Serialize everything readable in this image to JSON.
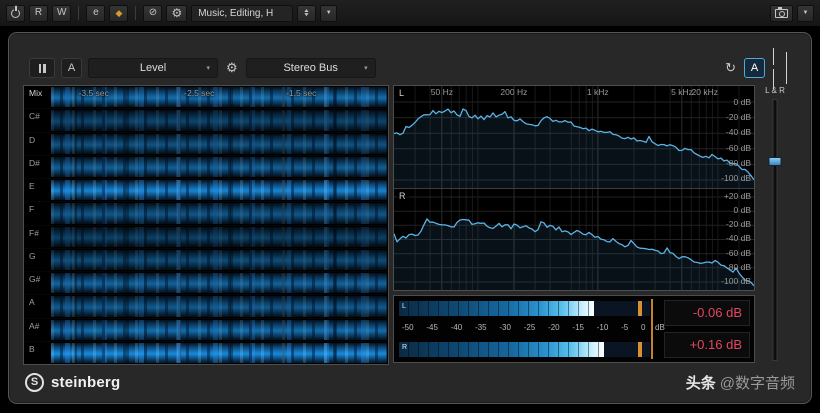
{
  "top_toolbar": {
    "read_button": "R",
    "write_button": "W",
    "edit_button": "e",
    "compare_icon": "◆",
    "bypass_icon": "⊘",
    "gear_icon": "⚙",
    "preset_value": "Music, Editing, H",
    "prev_icon": "▲",
    "next_icon": "▼",
    "menu_icon": "▼",
    "output_menu_icon": "▼"
  },
  "plugin": {
    "header": {
      "ab_button": "A",
      "module_select": "Level",
      "gear_icon": "⚙",
      "source_select": "Stereo Bus",
      "reset_icon": "↻",
      "snapshot_button": "A",
      "dropdown_icon": "▾"
    },
    "spectrogram": {
      "channel_label": "Mix",
      "time_labels": [
        "-3.5 sec",
        "-2.5 sec",
        "-1.5 sec"
      ],
      "note_labels": [
        "C#",
        "D",
        "D#",
        "E",
        "F",
        "F#",
        "G",
        "G#",
        "A",
        "A#",
        "B"
      ]
    },
    "spectrum": {
      "freq_labels": [
        "50 Hz",
        "200 Hz",
        "1 kHz",
        "5 kHz",
        "20 kHz"
      ],
      "left_channel": "L",
      "right_channel": "R",
      "left_db_labels": [
        "0 dB",
        "-20 dB",
        "-40 dB",
        "-60 dB",
        "-80 dB",
        "-100 dB"
      ],
      "right_db_labels": [
        "+20 dB",
        "0 dB",
        "-20 dB",
        "-40 dB",
        "-60 dB",
        "-80 dB",
        "-100 dB"
      ]
    },
    "meter": {
      "left_channel": "L",
      "right_channel": "R",
      "scale_ticks": [
        "-50",
        "-45",
        "-40",
        "-35",
        "-30",
        "-25",
        "-20",
        "-15",
        "-10",
        "-5",
        "0"
      ],
      "unit_label": "dB",
      "left_readout": "-0.06 dB",
      "right_readout": "+0.16 dB",
      "left_fill_pct": 78,
      "right_fill_pct": 82
    },
    "fader": {
      "label": "L & R"
    }
  },
  "footer": {
    "brand": "steinberg"
  },
  "watermark": {
    "logo_text": "头条",
    "handle_text": "@数字音频"
  },
  "colors": {
    "accent_blue": "#4fa8e0",
    "curve_blue": "#5ab2e6",
    "readout_red": "#e0495f",
    "meter_orange": "#d89030"
  }
}
